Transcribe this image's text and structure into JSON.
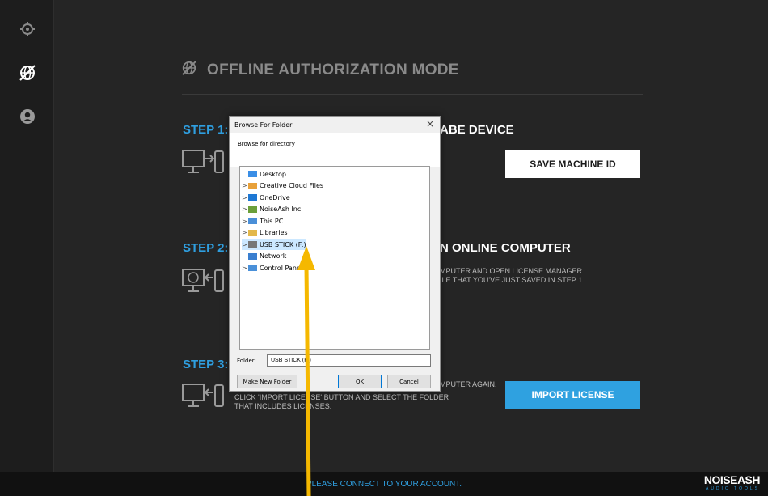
{
  "sidebar": {
    "items": [
      {
        "name": "settings-icon"
      },
      {
        "name": "offline-icon"
      },
      {
        "name": "account-icon"
      }
    ]
  },
  "main": {
    "title": "OFFLINE AUTHORIZATION MODE",
    "step1": {
      "label": "STEP 1:",
      "heading": "ABE DEVICE",
      "button": "SAVE MACHINE ID"
    },
    "step2": {
      "label": "STEP 2:",
      "heading": "N ONLINE COMPUTER",
      "desc_line1": "MPUTER AND OPEN LICENSE MANAGER.",
      "desc_line2": "ILE THAT YOU'VE JUST SAVED IN STEP 1."
    },
    "step3": {
      "label": "STEP 3:",
      "desc_right": "MPUTER AGAIN.",
      "desc_line2": "CLICK 'IMPORT LICENSE' BUTTON AND SELECT THE FOLDER",
      "desc_line3": "THAT INCLUDES LICENSES.",
      "button": "IMPORT LICENSE"
    }
  },
  "footer": {
    "status": "PLEASE CONNECT TO YOUR ACCOUNT.",
    "brand_name": "NOISEASH",
    "brand_sub": "AUDIO TOOLS"
  },
  "dialog": {
    "title": "Browse For Folder",
    "close": "×",
    "subtitle": "Browse for directory",
    "tree": [
      {
        "label": "Desktop",
        "arrow": "",
        "icon_color": "#3a8ee6"
      },
      {
        "label": "Creative Cloud Files",
        "arrow": ">",
        "icon_color": "#e8a13a"
      },
      {
        "label": "OneDrive",
        "arrow": ">",
        "icon_color": "#1e78d4"
      },
      {
        "label": "NoiseAsh Inc.",
        "arrow": ">",
        "icon_color": "#6b9f3a"
      },
      {
        "label": "This PC",
        "arrow": ">",
        "icon_color": "#4a8fd8"
      },
      {
        "label": "Libraries",
        "arrow": ">",
        "icon_color": "#e3b84a"
      },
      {
        "label": "USB STICK (F:)",
        "arrow": ">",
        "icon_color": "#777777"
      },
      {
        "label": "Network",
        "arrow": "",
        "icon_color": "#3a7fd0"
      },
      {
        "label": "Control Panel",
        "arrow": ">",
        "icon_color": "#4a90d9"
      }
    ],
    "folder_label": "Folder:",
    "folder_value": "USB STICK (F:)",
    "btn_new": "Make New Folder",
    "btn_ok": "OK",
    "btn_cancel": "Cancel"
  },
  "colors": {
    "accent": "#2f9fe0",
    "annotation_arrow": "#f5b800"
  }
}
